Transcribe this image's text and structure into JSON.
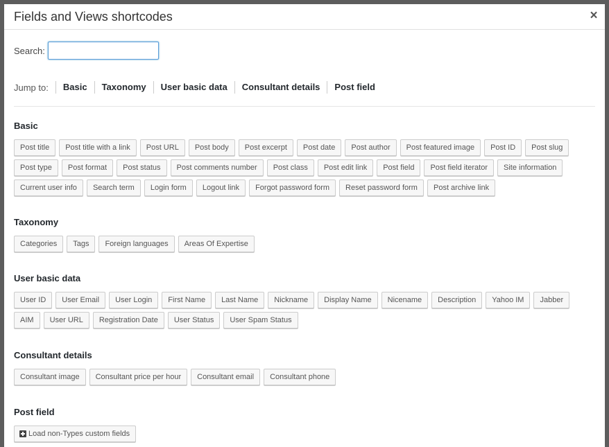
{
  "dialog": {
    "title": "Fields and Views shortcodes",
    "close_glyph": "×"
  },
  "search": {
    "label": "Search:",
    "value": ""
  },
  "jump": {
    "label": "Jump to:",
    "links": [
      "Basic",
      "Taxonomy",
      "User basic data",
      "Consultant details",
      "Post field"
    ]
  },
  "sections": {
    "basic": {
      "title": "Basic",
      "buttons": [
        "Post title",
        "Post title with a link",
        "Post URL",
        "Post body",
        "Post excerpt",
        "Post date",
        "Post author",
        "Post featured image",
        "Post ID",
        "Post slug",
        "Post type",
        "Post format",
        "Post status",
        "Post comments number",
        "Post class",
        "Post edit link",
        "Post field",
        "Post field iterator",
        "Site information",
        "Current user info",
        "Search term",
        "Login form",
        "Logout link",
        "Forgot password form",
        "Reset password form",
        "Post archive link"
      ]
    },
    "taxonomy": {
      "title": "Taxonomy",
      "buttons": [
        "Categories",
        "Tags",
        "Foreign languages",
        "Areas Of Expertise"
      ]
    },
    "user": {
      "title": "User basic data",
      "buttons": [
        "User ID",
        "User Email",
        "User Login",
        "First Name",
        "Last Name",
        "Nickname",
        "Display Name",
        "Nicename",
        "Description",
        "Yahoo IM",
        "Jabber",
        "AIM",
        "User URL",
        "Registration Date",
        "User Status",
        "User Spam Status"
      ]
    },
    "consultant": {
      "title": "Consultant details",
      "buttons": [
        "Consultant image",
        "Consultant price per hour",
        "Consultant email",
        "Consultant phone"
      ]
    },
    "postfield": {
      "title": "Post field",
      "load_button": "Load non-Types custom fields"
    }
  },
  "colors": {
    "overlay": "#6b6b6b",
    "dialog_bg": "#ffffff",
    "input_focus": "#5b9dd9"
  }
}
